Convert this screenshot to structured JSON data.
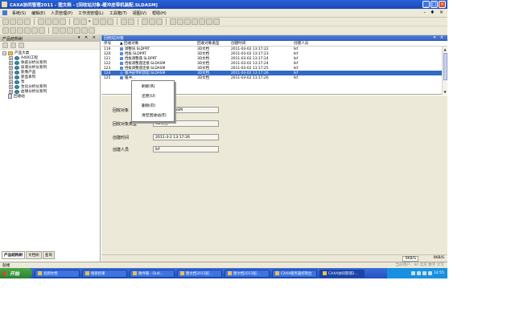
{
  "window": {
    "title": "CAXA协同管理2011 - 图文档 - [回收站对象-缓冲皮带机装配.SLDASM]"
  },
  "menu": [
    "系统(S)",
    "编辑(E)",
    "人员管理(P)",
    "工作流管理(L)",
    "工具箱(T)",
    "视图(V)",
    "帮助(H)"
  ],
  "left_panel": {
    "title": "产品结构树",
    "tree": [
      {
        "label": "产品大类",
        "level": 0,
        "icon": "folder"
      },
      {
        "label": "A400工程",
        "level": 1,
        "icon": "globe"
      },
      {
        "label": "免疫分析仪系列",
        "level": 1,
        "icon": "globe"
      },
      {
        "label": "尿液分析仪系列",
        "level": 1,
        "icon": "globe"
      },
      {
        "label": "影像产品",
        "level": 1,
        "icon": "globe"
      },
      {
        "label": "新品系列",
        "level": 1,
        "icon": "globe"
      },
      {
        "label": "泵",
        "level": 1,
        "icon": "globe"
      },
      {
        "label": "生化分析仪系列",
        "level": 1,
        "icon": "globe"
      },
      {
        "label": "血球分析仪系列",
        "level": 1,
        "icon": "globe"
      },
      {
        "label": "回收站",
        "level": 0,
        "icon": "recycle"
      }
    ],
    "tabs": [
      "产品结构树",
      "文档树",
      "查询"
    ]
  },
  "list_panel": {
    "title": "回收站对象",
    "columns": [
      "序号",
      "回收对象",
      "回收对象类型",
      "创建时间",
      "创建人员"
    ],
    "rows": [
      {
        "no": "119",
        "name": "调整块.SLDPRT",
        "type": "3D文档",
        "time": "2011-03-02 13:17:22",
        "creator": "lkf"
      },
      {
        "no": "120",
        "name": "挡板.SLDPRT",
        "type": "3D文档",
        "time": "2011-03-02 13:17:23",
        "creator": "lkf"
      },
      {
        "no": "121",
        "name": "挡板调整座.SLDPRT",
        "type": "3D文档",
        "time": "2011-03-02 13:17:24",
        "creator": "lkf"
      },
      {
        "no": "122",
        "name": "挡板调整座连接.SLDASM",
        "type": "3D文档",
        "time": "2011-03-02 13:17:24",
        "creator": "lkf"
      },
      {
        "no": "123",
        "name": "挡板调整座连接.SLDASM",
        "type": "3D文档",
        "time": "2011-03-02 13:17:25",
        "creator": "lkf"
      },
      {
        "no": "124",
        "name": "缓冲皮带机装配.SLDASM",
        "type": "3D文档",
        "time": "2011-03-02 13:17:26",
        "creator": "lkf",
        "selected": true
      },
      {
        "no": "125",
        "name": "缓冲...",
        "type": "3D文档",
        "time": "2011-03-02 13:17:26",
        "creator": "lkf"
      }
    ]
  },
  "detail": {
    "object_label": "回收对象",
    "object_value": "...装配.SLDASM",
    "type_label": "回收对象类型",
    "type_value": "3D文档",
    "time_label": "创建时间",
    "time_value": "2011-3-2 13:17:26",
    "creator_label": "创建人员",
    "creator_value": "lkf"
  },
  "context_menu": [
    "刷新(R)",
    "还原(U)",
    "删除(D)",
    "清空回收站(E)"
  ],
  "bottom": {
    "zoom": "0KB/S",
    "zoom2": "0KB/S"
  },
  "status": {
    "left": "就绪",
    "right": "当前用户：lkf 北京 数字 大写"
  },
  "taskbar": {
    "start": "开始",
    "tasks": [
      "北网文档",
      "搜索结果",
      "收件箱 - Outl...",
      "图文档2011配...",
      "图文档2011配...",
      "CAXA服务器控制台",
      "CAXA协同管理2..."
    ],
    "clock": "14:55"
  },
  "colors": {
    "title_bar": "#1848b8",
    "selection": "#316ac5",
    "chrome": "#ece9d8"
  }
}
